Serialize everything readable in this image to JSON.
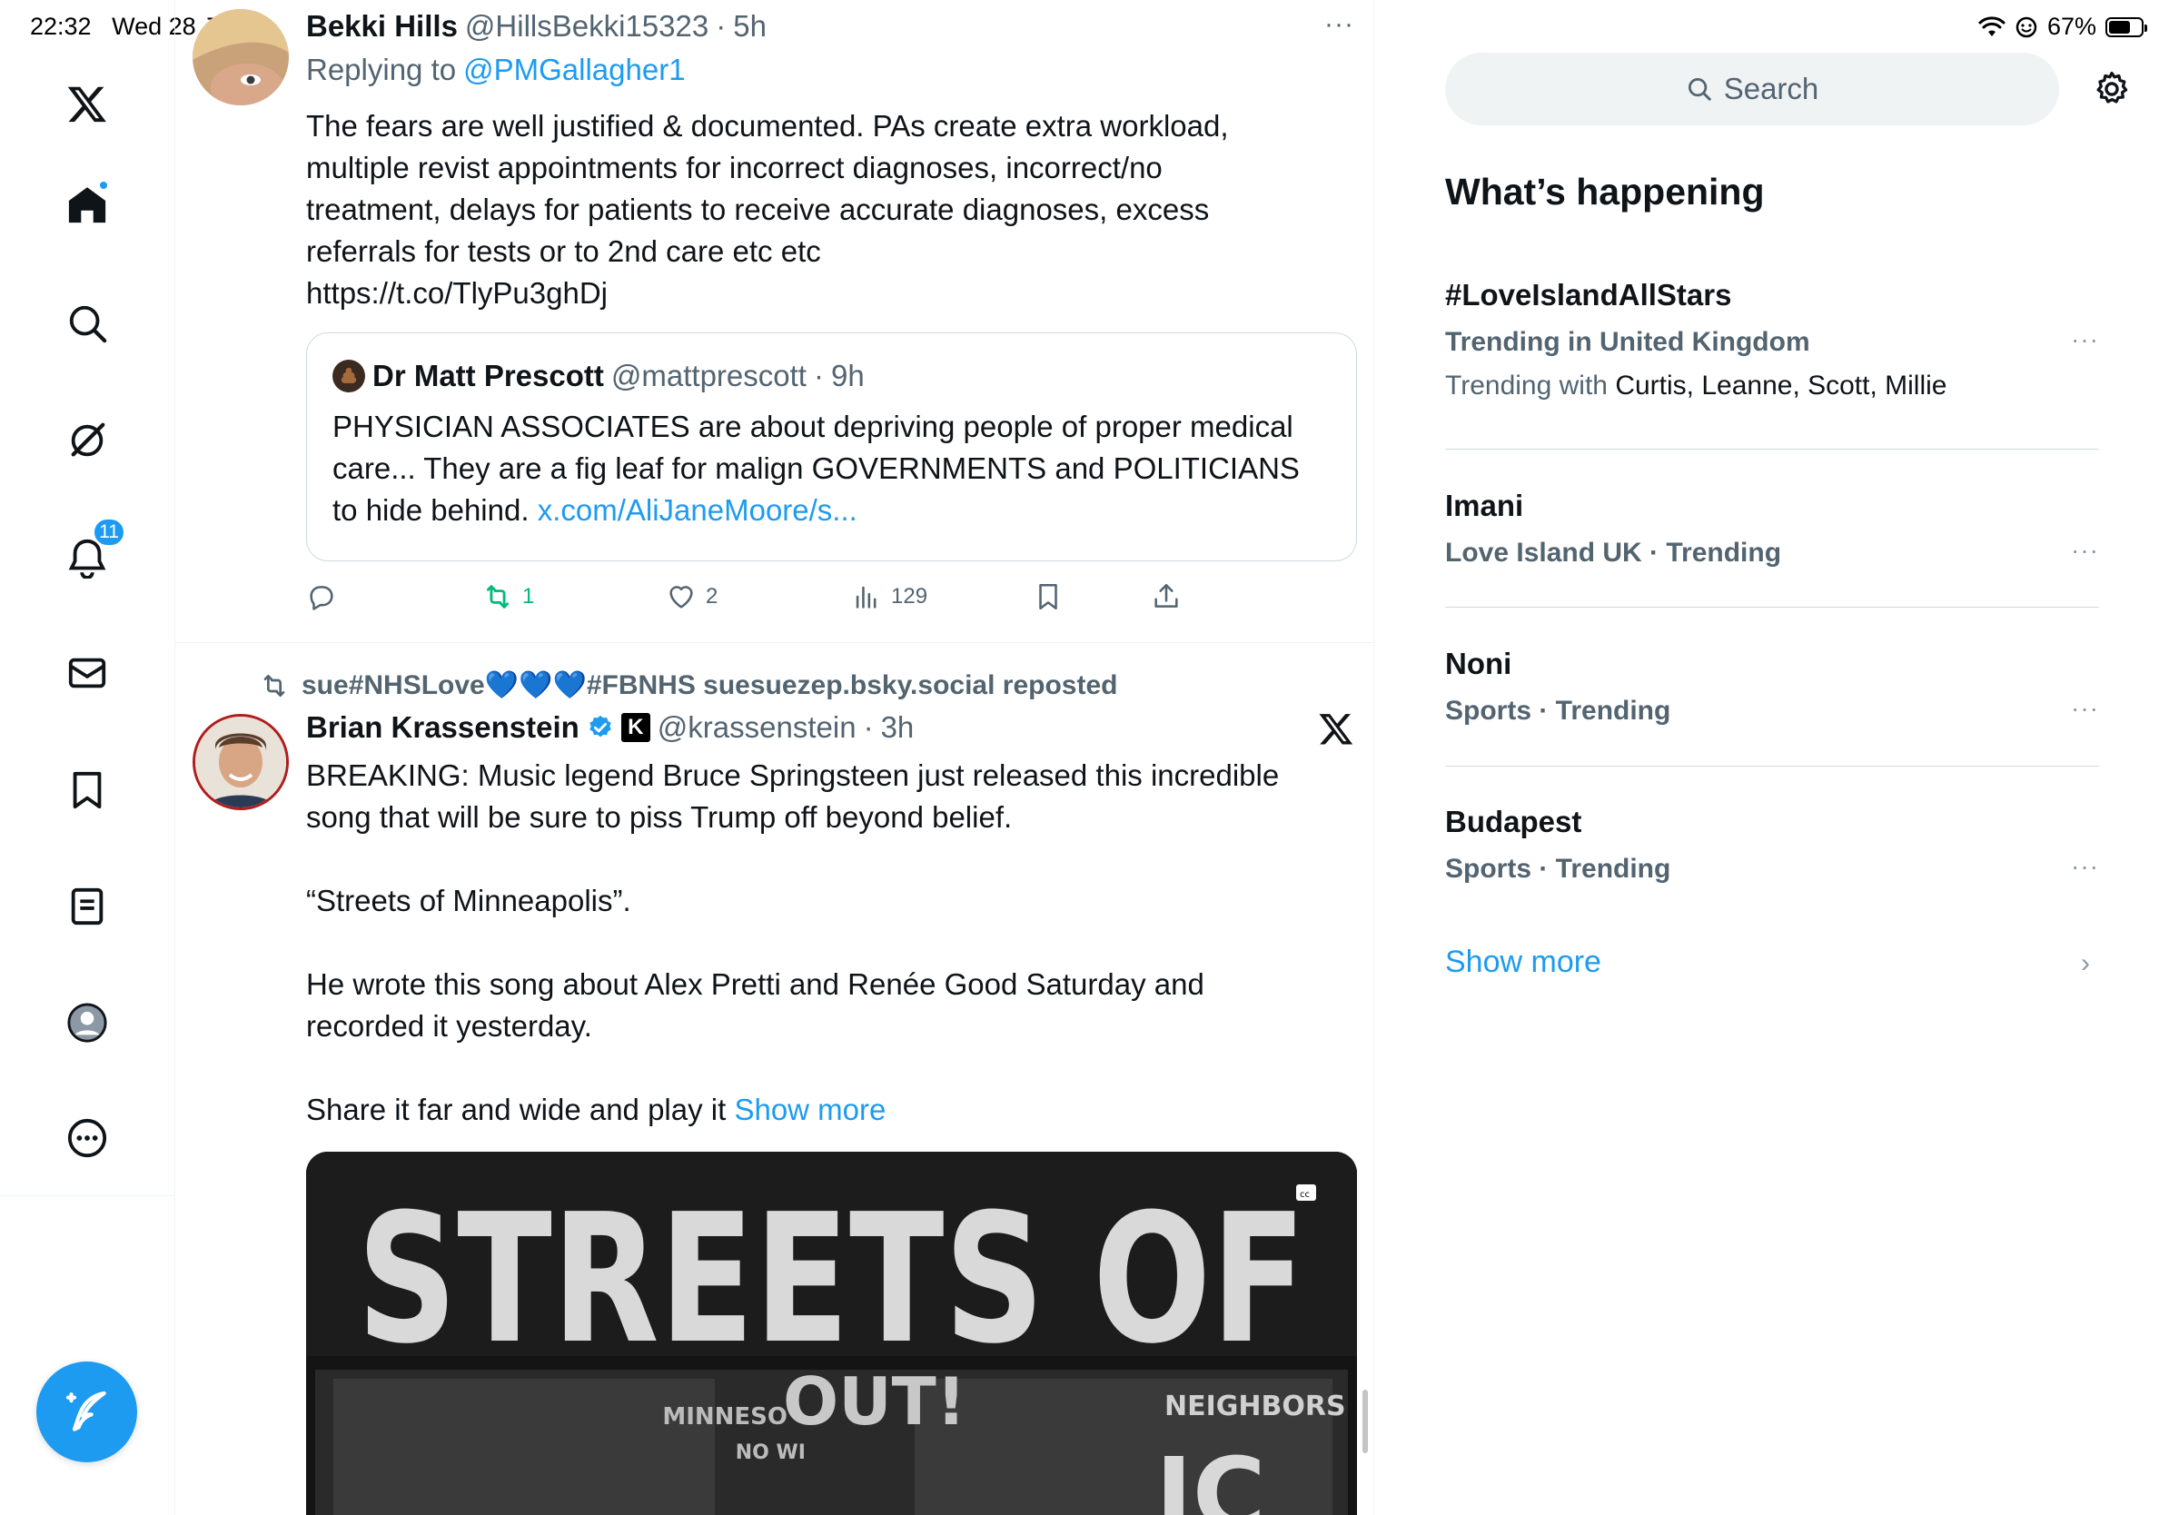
{
  "status_bar": {
    "time": "22:32",
    "date": "Wed 28 Jan",
    "battery": "67%",
    "battery_level": 0.67
  },
  "nav": {
    "items": [
      {
        "name": "x-logo-icon"
      },
      {
        "name": "home-icon"
      },
      {
        "name": "explore-icon"
      },
      {
        "name": "grok-icon"
      },
      {
        "name": "notifications-icon",
        "badge": "11"
      },
      {
        "name": "messages-icon"
      },
      {
        "name": "bookmarks-icon"
      },
      {
        "name": "lists-icon"
      },
      {
        "name": "profile-icon"
      },
      {
        "name": "more-icon"
      }
    ],
    "compose_icon": "compose-icon"
  },
  "tweets": [
    {
      "display_name": "Bekki Hills",
      "handle": "@HillsBekki15323",
      "time": "5h",
      "replying_prefix": "Replying to",
      "replying_to": "@PMGallagher1",
      "text_lines": [
        "The fears are well justified & documented. PAs create extra workload,",
        "multiple revist appointments for incorrect diagnoses, incorrect/no",
        "treatment, delays for patients to receive accurate diagnoses, excess",
        "referrals for tests or to 2nd care etc etc",
        "https://t.co/TlyPu3ghDj"
      ],
      "quote": {
        "display_name": "Dr Matt Prescott",
        "handle": "@mattprescott",
        "time": "9h",
        "text_lines": [
          "PHYSICIAN ASSOCIATES are about depriving people of proper medical",
          "care... They are a fig leaf for malign GOVERNMENTS and POLITICIANS"
        ],
        "last_line_prefix": "to hide behind.",
        "link": "x.com/AliJaneMoore/s..."
      },
      "actions": {
        "reposts": "1",
        "likes": "2",
        "views": "129"
      }
    },
    {
      "repost_by": "sue#NHSLove",
      "repost_hearts": "💙💙💙",
      "repost_suffix": "#FBNHS suesuezep.bsky.social reposted",
      "display_name": "Brian Krassenstein",
      "badge_letter": "K",
      "handle": "@krassenstein",
      "time": "3h",
      "paragraphs": [
        "BREAKING: Music legend Bruce Springsteen just released this incredible",
        "song that will be sure to piss Trump off beyond belief.",
        "“Streets of Minneapolis”.",
        "He wrote this song about Alex Pretti and Renée Good Saturday and",
        "recorded it yesterday.",
        "Share it far and wide and play it"
      ],
      "show_more": "Show more",
      "media": {
        "headline": "STREETS OF",
        "cc_label": "cc",
        "sign_1": "MINNESO",
        "sign_2": "NO WI",
        "sign_3": "OUT!",
        "sign_4": "NEIGHBORS",
        "sign_5": "IC"
      }
    }
  ],
  "right": {
    "search_placeholder": "Search",
    "section_title": "What’s happening",
    "trends": [
      {
        "name": "#LoveIslandAllStars",
        "meta": "Trending in United Kingdom",
        "with_prefix": "Trending with",
        "with_names": "Curtis, Leanne, Scott, Millie"
      },
      {
        "name": "Imani",
        "meta": "Love Island UK · Trending"
      },
      {
        "name": "Noni",
        "meta": "Sports · Trending"
      },
      {
        "name": "Budapest",
        "meta": "Sports · Trending"
      }
    ],
    "show_more": "Show more"
  }
}
